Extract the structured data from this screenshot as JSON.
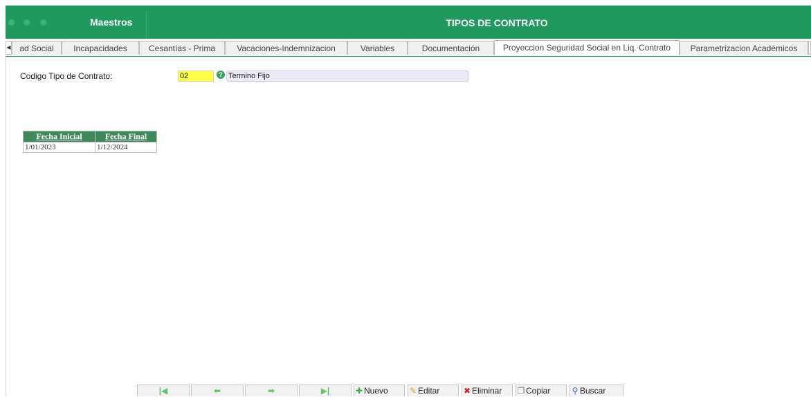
{
  "header": {
    "app_title": "Maestros",
    "window_title": "TIPOS DE CONTRATO",
    "accent": "#1f9a5c"
  },
  "tabs": [
    {
      "label": "ad Social"
    },
    {
      "label": "Incapacidades"
    },
    {
      "label": "Cesantías - Prima"
    },
    {
      "label": "Vacaciones-Indemnizacion"
    },
    {
      "label": "Variables"
    },
    {
      "label": "Documentación"
    },
    {
      "label": "Proyeccion Seguridad Social en Liq. Contrato",
      "active": true
    },
    {
      "label": "Parametrizacion Académicos"
    }
  ],
  "form": {
    "codigo_label": "Codigo Tipo de Contrato:",
    "codigo_value": "02",
    "descripcion": "Termino Fijo"
  },
  "table": {
    "headers": [
      "Fecha Inicial",
      "Fecha Final"
    ],
    "rows": [
      [
        "1/01/2023",
        "1/12/2024"
      ]
    ]
  },
  "toolbar": {
    "nuevo": "Nuevo",
    "editar": "Editar",
    "eliminar": "Eliminar",
    "copiar": "Copiar",
    "buscar": "Buscar"
  }
}
